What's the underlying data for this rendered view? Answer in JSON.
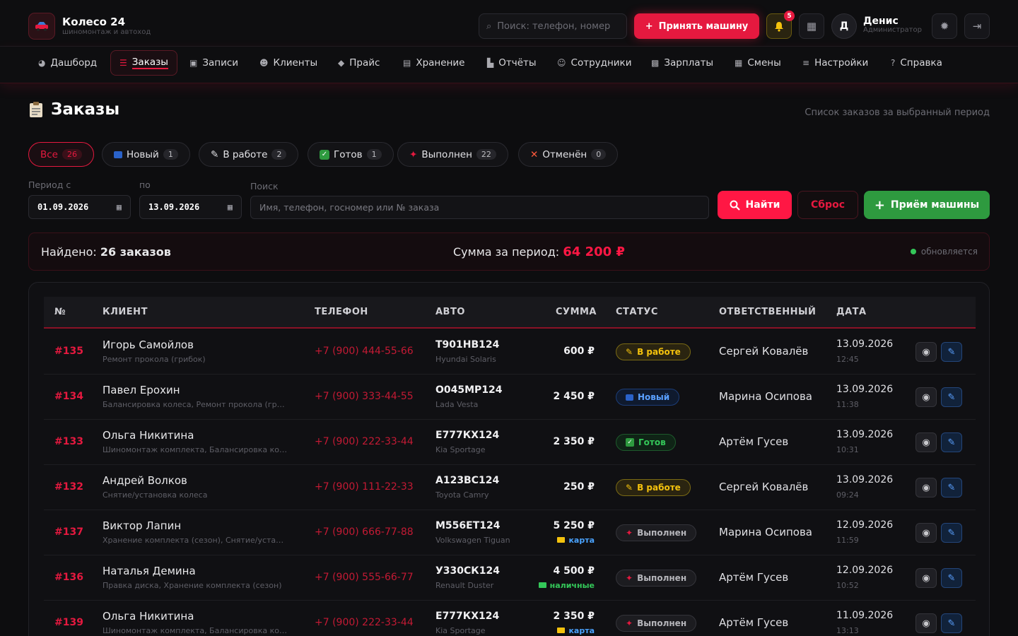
{
  "app": {
    "name": "Колесо 24",
    "tagline": "шиномонтаж и автоход",
    "logo_icon": "car-icon"
  },
  "header": {
    "search_placeholder": "Поиск: телефон, номер",
    "accept_label": "Принять машину",
    "notification_count": "5",
    "user_initial": "Д",
    "user_name": "Денис",
    "user_role": "Администратор"
  },
  "nav": [
    {
      "label": "Дашборд",
      "icon": "dashboard-icon",
      "glyph": "◕"
    },
    {
      "label": "Заказы",
      "icon": "orders-icon",
      "glyph": "☰",
      "active": true
    },
    {
      "label": "Записи",
      "icon": "calendar-icon",
      "glyph": "▣"
    },
    {
      "label": "Клиенты",
      "icon": "users-icon",
      "glyph": "☻"
    },
    {
      "label": "Прайс",
      "icon": "tag-icon",
      "glyph": "◆"
    },
    {
      "label": "Хранение",
      "icon": "warehouse-icon",
      "glyph": "▤"
    },
    {
      "label": "Отчёты",
      "icon": "chart-icon",
      "glyph": "▙"
    },
    {
      "label": "Сотрудники",
      "icon": "staff-icon",
      "glyph": "☺"
    },
    {
      "label": "Зарплаты",
      "icon": "money-icon",
      "glyph": "▩"
    },
    {
      "label": "Смены",
      "icon": "shifts-icon",
      "glyph": "▦"
    },
    {
      "label": "Настройки",
      "icon": "sliders-icon",
      "glyph": "≡"
    },
    {
      "label": "Справка",
      "icon": "help-icon",
      "glyph": "?"
    }
  ],
  "page": {
    "title": "Заказы",
    "subtitle": "Список заказов за выбранный период"
  },
  "filters": [
    {
      "label": "Все",
      "count": "26",
      "active": true
    },
    {
      "label": "Новый",
      "count": "1",
      "icon": "new-badge-icon"
    },
    {
      "label": "В работе",
      "count": "2",
      "icon": "pencil-icon"
    },
    {
      "label": "Готов",
      "count": "1",
      "icon": "check-icon"
    },
    {
      "label": "Выполнен",
      "count": "22",
      "icon": "pin-icon"
    },
    {
      "label": "Отменён",
      "count": "0",
      "icon": "cross-icon"
    }
  ],
  "form": {
    "period_from_label": "Период с",
    "period_to_label": "по",
    "search_label": "Поиск",
    "date_from": "01.09.2026",
    "date_to": "13.09.2026",
    "search_placeholder": "Имя, телефон, госномер или № заказа",
    "find_label": "Найти",
    "reset_label": "Сброс",
    "receive_label": "Приём машины"
  },
  "summary": {
    "found_label": "Найдено:",
    "found_count": "26 заказов",
    "total_label": "Сумма за период:",
    "total_value": "64 200 ₽",
    "status_text": "обновляется"
  },
  "table": {
    "columns": [
      "№",
      "КЛИЕНТ",
      "ТЕЛЕФОН",
      "АВТО",
      "СУММА",
      "СТАТУС",
      "ОТВЕТСТВЕННЫЙ",
      "ДАТА"
    ],
    "rows": [
      {
        "id": "#135",
        "name": "Игорь Самойлов",
        "service": "Ремонт прокола (грибок)",
        "phone": "+7 (900) 444-55-66",
        "plate": "Т901НВ124",
        "car": "Hyundai Solaris",
        "sum": "600 ₽",
        "pay": "",
        "status": "В работе",
        "status_type": "work",
        "resp": "Сергей Ковалёв",
        "date": "13.09.2026",
        "time": "12:45"
      },
      {
        "id": "#134",
        "name": "Павел Ерохин",
        "service": "Балансировка колеса, Ремонт прокола (грибок)",
        "phone": "+7 (900) 333-44-55",
        "plate": "О045МР124",
        "car": "Lada Vesta",
        "sum": "2 450 ₽",
        "pay": "",
        "status": "Новый",
        "status_type": "new",
        "resp": "Марина Осипова",
        "date": "13.09.2026",
        "time": "11:38"
      },
      {
        "id": "#133",
        "name": "Ольга Никитина",
        "service": "Шиномонтаж комплекта, Балансировка колёс",
        "phone": "+7 (900) 222-33-44",
        "plate": "Е777КХ124",
        "car": "Kia Sportage",
        "sum": "2 350 ₽",
        "pay": "",
        "status": "Готов",
        "status_type": "ready",
        "resp": "Артём Гусев",
        "date": "13.09.2026",
        "time": "10:31"
      },
      {
        "id": "#132",
        "name": "Андрей Волков",
        "service": "Снятие/установка колеса",
        "phone": "+7 (900) 111-22-33",
        "plate": "А123ВС124",
        "car": "Toyota Camry",
        "sum": "250 ₽",
        "pay": "",
        "status": "В работе",
        "status_type": "work",
        "resp": "Сергей Ковалёв",
        "date": "13.09.2026",
        "time": "09:24"
      },
      {
        "id": "#137",
        "name": "Виктор Лапин",
        "service": "Хранение комплекта (сезон), Снятие/установка колёс",
        "phone": "+7 (900) 666-77-88",
        "plate": "М556ЕТ124",
        "car": "Volkswagen Tiguan",
        "sum": "5 250 ₽",
        "pay": "карта",
        "pay_type": "card",
        "status": "Выполнен",
        "status_type": "done",
        "resp": "Марина Осипова",
        "date": "12.09.2026",
        "time": "11:59"
      },
      {
        "id": "#136",
        "name": "Наталья Демина",
        "service": "Правка диска, Хранение комплекта (сезон)",
        "phone": "+7 (900) 555-66-77",
        "plate": "У330СК124",
        "car": "Renault Duster",
        "sum": "4 500 ₽",
        "pay": "наличные",
        "pay_type": "cash",
        "status": "Выполнен",
        "status_type": "done",
        "resp": "Артём Гусев",
        "date": "12.09.2026",
        "time": "10:52"
      },
      {
        "id": "#139",
        "name": "Ольга Никитина",
        "service": "Шиномонтаж комплекта, Балансировка колёс",
        "phone": "+7 (900) 222-33-44",
        "plate": "Е777КХ124",
        "car": "Kia Sportage",
        "sum": "2 350 ₽",
        "pay": "карта",
        "pay_type": "card",
        "status": "Выполнен",
        "status_type": "done",
        "resp": "Артём Гусев",
        "date": "11.09.2026",
        "time": "13:13"
      }
    ]
  },
  "colors": {
    "accent": "#e5193f",
    "success": "#2e9a3f",
    "warning": "#f4c20d",
    "info": "#5aa0ff",
    "background": "#0d0d0f"
  }
}
